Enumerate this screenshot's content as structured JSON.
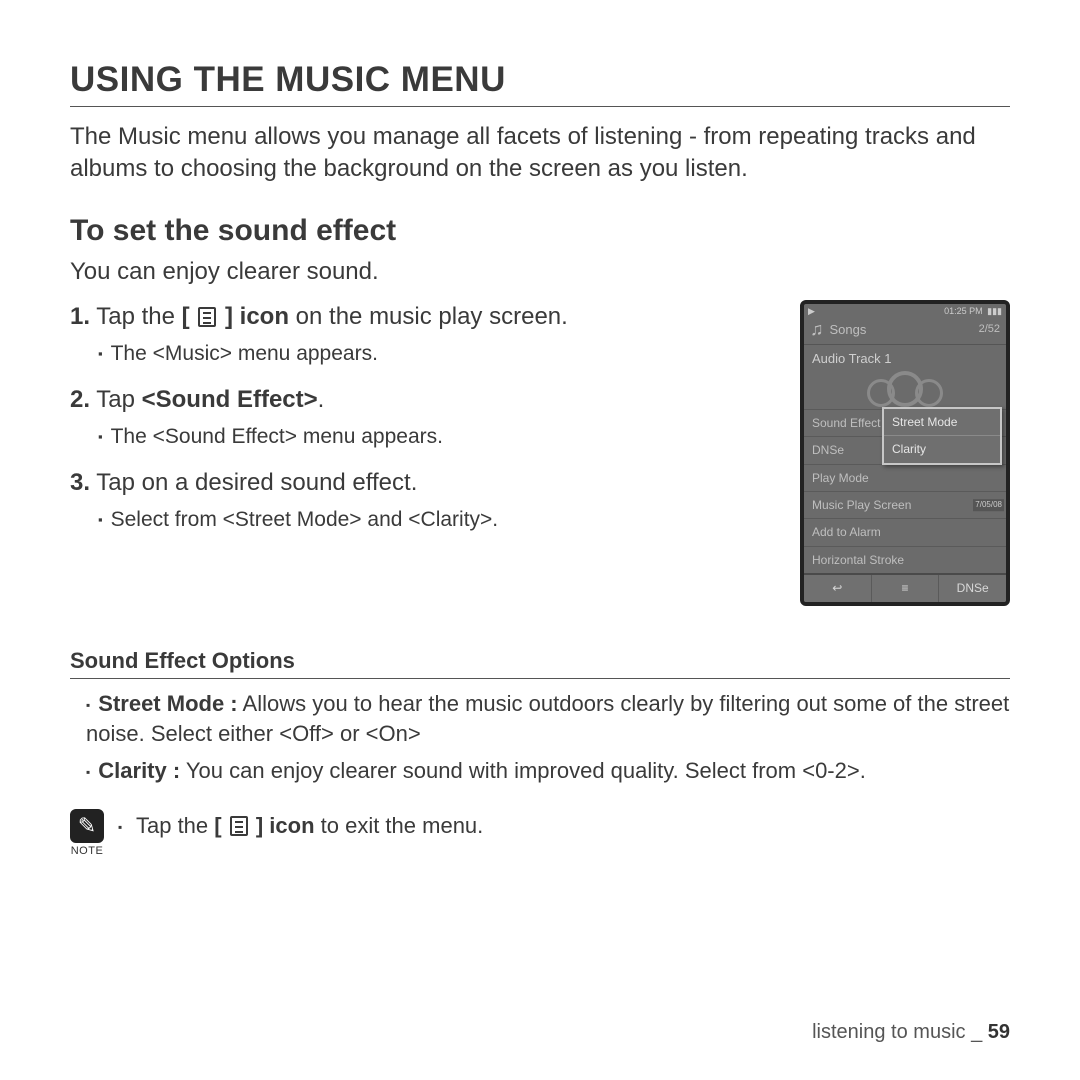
{
  "title": "USING THE MUSIC MENU",
  "intro": "The Music menu allows you manage all facets of listening - from repeating tracks and albums to choosing the background on the screen as you listen.",
  "section_title": "To set the sound effect",
  "section_intro": "You can enjoy clearer sound.",
  "steps": [
    {
      "num": "1.",
      "pre": "Tap the ",
      "bracket_open": "[ ",
      "bracket_close": " ] ",
      "post_bold": "icon",
      "post": " on the music play screen.",
      "sub": [
        "The <Music> menu appears."
      ]
    },
    {
      "num": "2.",
      "pre": "Tap ",
      "bold": "<Sound Effect>",
      "post": ".",
      "sub": [
        "The <Sound Effect> menu appears."
      ]
    },
    {
      "num": "3.",
      "pre": "Tap on a desired sound effect.",
      "sub": [
        "Select from <Street Mode> and <Clarity>."
      ]
    }
  ],
  "device": {
    "status": {
      "play_glyph": "▶",
      "time": "01:25 PM",
      "batt_glyph": "▮▮▮"
    },
    "header": {
      "icon_name": "music-note-icon",
      "title": "Songs",
      "count": "2/52"
    },
    "track": "Audio Track 1",
    "menu_items": [
      "Sound Effect",
      "DNSe",
      "Play Mode",
      "Music Play Screen",
      "Add to Alarm",
      "Horizontal Stroke"
    ],
    "date_tag": "7/05/08",
    "popup": [
      "Street Mode",
      "Clarity"
    ],
    "bottom": {
      "back_glyph": "↩",
      "menu_glyph": "≡",
      "dnse": "DNSe"
    }
  },
  "options_heading": "Sound Effect Options",
  "options": [
    {
      "label": "Street Mode :",
      "desc": " Allows you to hear the music outdoors clearly by filtering out some of the street noise. Select either <Off> or <On>"
    },
    {
      "label": "Clarity :",
      "desc": " You can enjoy clearer sound with improved quality. Select from <0-2>."
    }
  ],
  "note": {
    "badge_label": "NOTE",
    "pre": "Tap the ",
    "bracket_open": "[ ",
    "bracket_close": " ] ",
    "post_bold": "icon",
    "post": " to exit the menu."
  },
  "footer": {
    "section": "listening to music _ ",
    "page": "59"
  }
}
